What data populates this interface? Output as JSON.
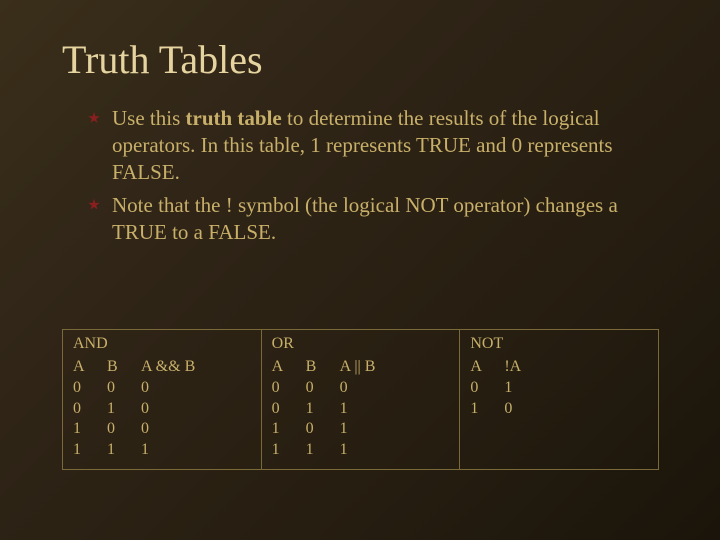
{
  "title": "Truth Tables",
  "bullets": [
    {
      "pre": "Use this ",
      "bold": "truth table",
      "post": " to determine the results of the logical operators. In this table, 1 represents TRUE and 0 represents FALSE."
    },
    {
      "pre": "Note that the ! symbol (the logical NOT operator) changes a TRUE to a FALSE.",
      "bold": "",
      "post": ""
    }
  ],
  "tables": {
    "and": {
      "title": "AND",
      "headers": [
        "A",
        "B",
        "A && B"
      ],
      "rows": [
        [
          "0",
          "0",
          "0"
        ],
        [
          "0",
          "1",
          "0"
        ],
        [
          "1",
          "0",
          "0"
        ],
        [
          "1",
          "1",
          "1"
        ]
      ]
    },
    "or": {
      "title": "OR",
      "headers": [
        "A",
        "B",
        "A || B"
      ],
      "rows": [
        [
          "0",
          "0",
          "0"
        ],
        [
          "0",
          "1",
          "1"
        ],
        [
          "1",
          "0",
          "1"
        ],
        [
          "1",
          "1",
          "1"
        ]
      ]
    },
    "not": {
      "title": "NOT",
      "headers": [
        "A",
        "!A"
      ],
      "rows": [
        [
          "0",
          "1"
        ],
        [
          "1",
          "0"
        ]
      ]
    }
  },
  "chart_data": [
    {
      "type": "table",
      "title": "AND",
      "columns": [
        "A",
        "B",
        "A && B"
      ],
      "rows": [
        [
          0,
          0,
          0
        ],
        [
          0,
          1,
          0
        ],
        [
          1,
          0,
          0
        ],
        [
          1,
          1,
          1
        ]
      ]
    },
    {
      "type": "table",
      "title": "OR",
      "columns": [
        "A",
        "B",
        "A || B"
      ],
      "rows": [
        [
          0,
          0,
          0
        ],
        [
          0,
          1,
          1
        ],
        [
          1,
          0,
          1
        ],
        [
          1,
          1,
          1
        ]
      ]
    },
    {
      "type": "table",
      "title": "NOT",
      "columns": [
        "A",
        "!A"
      ],
      "rows": [
        [
          0,
          1
        ],
        [
          1,
          0
        ]
      ]
    }
  ]
}
